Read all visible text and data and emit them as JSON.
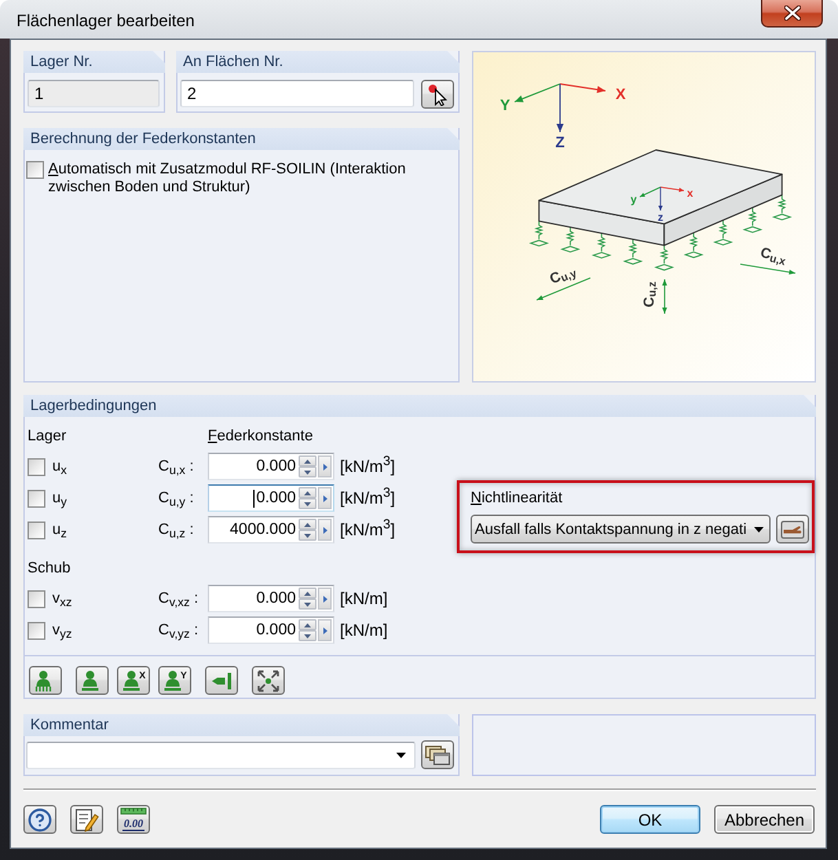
{
  "window": {
    "title": "Flächenlager bearbeiten"
  },
  "support_number": {
    "label": "Lager Nr.",
    "value": "1",
    "disabled": true
  },
  "surface_numbers": {
    "label": "An Flächen Nr.",
    "value": "2",
    "disabled": false
  },
  "spring_constants_calculation": {
    "title": "Berechnung der Federkonstanten",
    "option": {
      "label": "Automatisch mit Zusatzmodul RF-SOILIN (Interaktion zwischen Boden und Struktur)",
      "checked": false,
      "mnemonic": true
    }
  },
  "diagram": {
    "global_axes": [
      "X",
      "Y",
      "Z"
    ],
    "local_axes": [
      "x",
      "y",
      "z"
    ],
    "spring_labels": [
      {
        "base": "C",
        "sub": "u,y"
      },
      {
        "base": "C",
        "sub": "u,z"
      },
      {
        "base": "C",
        "sub": "u,x"
      }
    ]
  },
  "support_conditions": {
    "title": "Lagerbedingungen",
    "spring_heading": {
      "label": "Federkonstante",
      "mnemonic": true
    },
    "sections": [
      {
        "heading": "Lager",
        "rows": [
          {
            "dof": "u$_{x}$",
            "checked": false,
            "constant": "C$_{u,x}$ :",
            "value": "0.000",
            "focused": false,
            "unit": "[kN/m$^{3}$]"
          },
          {
            "dof": "u$_{y}$",
            "checked": false,
            "constant": "C$_{u,y}$ :",
            "value": "0.000",
            "focused": true,
            "unit": "[kN/m$^{3}$]"
          },
          {
            "dof": "u$_{z}$",
            "checked": false,
            "constant": "C$_{u,z}$ :",
            "value": "4000.000",
            "focused": false,
            "unit": "[kN/m$^{3}$]"
          }
        ]
      },
      {
        "heading": "Schub",
        "rows": [
          {
            "dof": "v$_{xz}$",
            "checked": false,
            "constant": "C$_{v,xz}$ :",
            "value": "0.000",
            "focused": false,
            "unit": "[kN/m]"
          },
          {
            "dof": "v$_{yz}$",
            "checked": false,
            "constant": "C$_{v,yz}$ :",
            "value": "0.000",
            "focused": false,
            "unit": "[kN/m]"
          }
        ]
      }
    ],
    "nonlinearity": {
      "label": "Nichtlinearität",
      "mnemonic": true,
      "value": "Ausfall falls Kontaktspannung in z negati",
      "highlighted": true
    }
  },
  "toolbar": [
    {
      "kind": "springs"
    },
    {
      "kind": "support"
    },
    {
      "kind": "support",
      "badge": "X"
    },
    {
      "kind": "support",
      "badge": "Y"
    },
    {
      "kind": "arrow_bar"
    },
    {
      "kind": "expand"
    }
  ],
  "comment": {
    "label": "Kommentar"
  },
  "footer": {
    "tools": [
      {
        "kind": "help"
      },
      {
        "kind": "edit"
      },
      {
        "kind": "units",
        "badge": "0.00"
      }
    ],
    "buttons": [
      {
        "label": "OK",
        "default": true
      },
      {
        "label": "Abbrechen",
        "default": false
      }
    ]
  }
}
